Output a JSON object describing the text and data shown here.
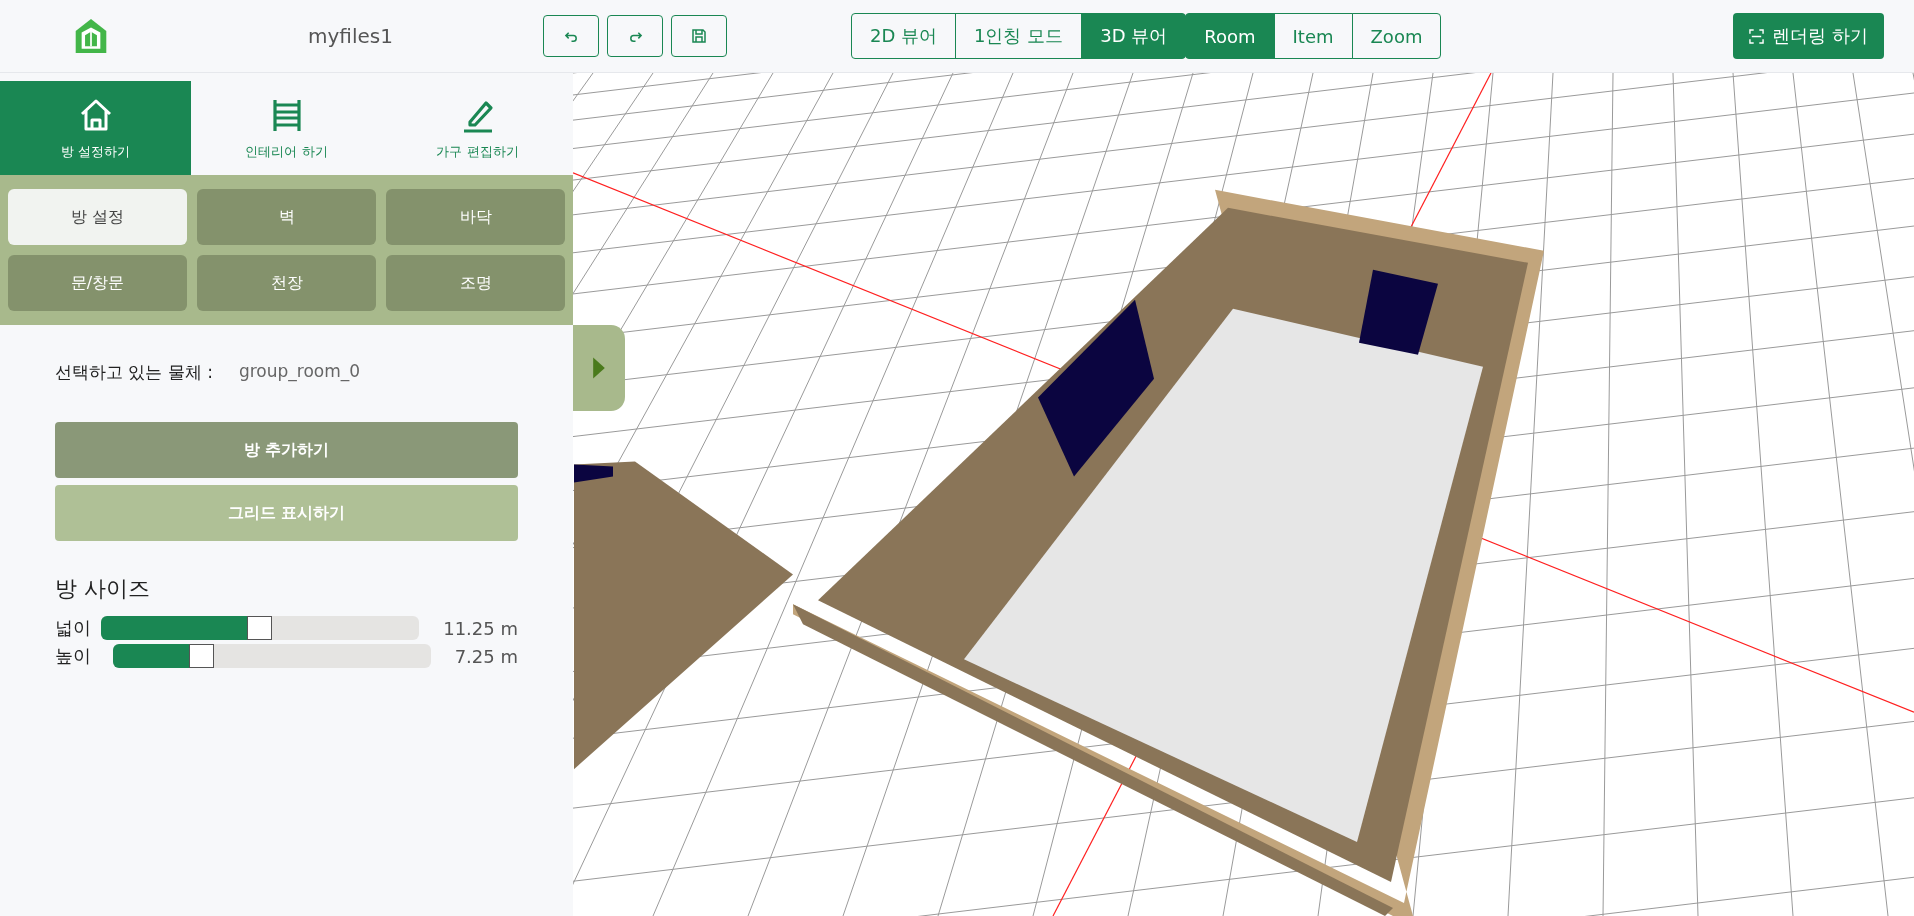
{
  "header": {
    "file_name": "myfiles1",
    "render_button": "렌더링 하기"
  },
  "view_modes": [
    {
      "label": "2D 뷰어",
      "selected": false
    },
    {
      "label": "1인칭 모드",
      "selected": false
    },
    {
      "label": "3D 뷰어",
      "selected": true
    }
  ],
  "target_modes": [
    {
      "label": "Room",
      "selected": true
    },
    {
      "label": "Item",
      "selected": false
    },
    {
      "label": "Zoom",
      "selected": false
    }
  ],
  "main_tabs": [
    {
      "label": "방 설정하기",
      "kind": "house",
      "selected": true
    },
    {
      "label": "인테리어 하기",
      "kind": "bed",
      "selected": false
    },
    {
      "label": "가구 편집하기",
      "kind": "pen",
      "selected": false
    }
  ],
  "sub_tabs": [
    {
      "label": "방 설정",
      "selected": true
    },
    {
      "label": "벽",
      "selected": false
    },
    {
      "label": "바닥",
      "selected": false
    },
    {
      "label": "문/창문",
      "selected": false
    },
    {
      "label": "천장",
      "selected": false
    },
    {
      "label": "조명",
      "selected": false
    }
  ],
  "selection": {
    "label": "선택하고 있는 물체 :",
    "value": "group_room_0"
  },
  "actions": [
    {
      "label": "방 추가하기",
      "kind": "primary"
    },
    {
      "label": "그리드 표시하기",
      "kind": "secondary"
    }
  ],
  "room_size": {
    "title": "방 사이즈",
    "sliders": [
      {
        "label": "넓이",
        "level": 0.51,
        "reading": "11.25 m"
      },
      {
        "label": "높이",
        "level": 0.29,
        "reading": "7.25 m"
      }
    ]
  }
}
